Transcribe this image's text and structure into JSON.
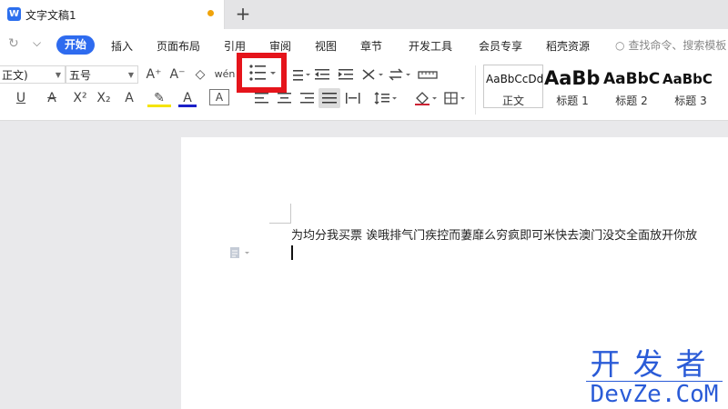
{
  "tabs": {
    "doc_title": "文字文稿1",
    "app_icon": "W",
    "new_tab": "+"
  },
  "menu": {
    "redo": "↻",
    "quick": "⌵",
    "items": [
      "开始",
      "插入",
      "页面布局",
      "引用",
      "审阅",
      "视图",
      "章节",
      "开发工具",
      "会员专享",
      "稻壳资源"
    ],
    "search_placeholder": "查找命令、搜索模板"
  },
  "toolbar": {
    "font_name": "正文)",
    "font_size": "五号",
    "grow": "A⁺",
    "shrink": "A⁻",
    "clear": "◇",
    "phonetic": "wén",
    "bold_u": "U",
    "strike": "A",
    "sup": "X²",
    "sub": "X₂",
    "effect": "A",
    "highlight": "✎",
    "font_color": "A",
    "char_border": "A"
  },
  "styles": [
    {
      "sample": "AaBbCcDd",
      "name": "正文"
    },
    {
      "sample": "AaBb",
      "name": "标题 1"
    },
    {
      "sample": "AaBbC",
      "name": "标题 2"
    },
    {
      "sample": "AaBbC",
      "name": "标题 3"
    }
  ],
  "document": {
    "text": "为均分我买票 诶哦排气门疾控而萋靡么穷疯即可米快去澳门没交全面放开你放"
  },
  "watermark": {
    "top": "开发者",
    "bottom": "DevZe.CoM"
  },
  "colors": {
    "accent": "#2e6bef",
    "highlight_box": "#e5141b",
    "watermark": "#2a5bd7"
  }
}
